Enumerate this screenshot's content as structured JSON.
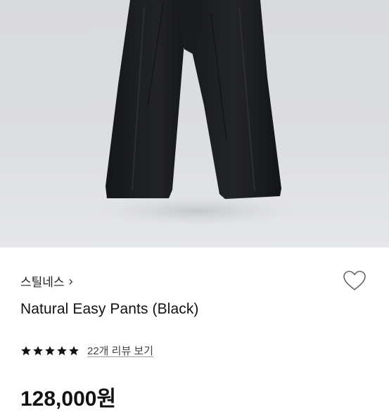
{
  "product": {
    "brand": "스틸네스",
    "brand_chevron": "›",
    "name": "Natural Easy Pants (Black)",
    "rating": 5,
    "rating_max": 5,
    "review_link": "22개 리뷰 보기",
    "price": "128,000원"
  },
  "icons": {
    "brand_chevron": "chevron-right-icon",
    "wishlist": "heart-outline-icon",
    "rating": "star-icon"
  },
  "colors": {
    "text_primary": "#111111",
    "star": "#111111",
    "hero_background": "#dcdddf",
    "product": "#1b1c1e"
  }
}
